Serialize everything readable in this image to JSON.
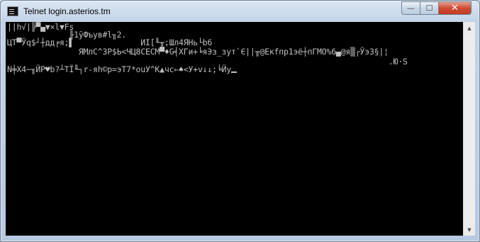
{
  "window": {
    "title": "Telnet login.asterios.tm",
    "buttons": {
      "minimize": "—",
      "maximize": "☐",
      "close": "✕"
    }
  },
  "console": {
    "lines": [
      "||h√|╠▀▄▼×l▼Fs",
      "             ╟1ўФъув#l╖2.",
      "ЦТ▀Ўq$┘┼дд╒я;▌              ИI[╙╥;Шл4ЯНь└b6",
      "               ЯМлС^3Р$Ь<ЧЦ8СЕСМ▀♦G╡ХГи+╘яЭз_зут`Є||╥@Екfпр1эё┼пГМО%6▄@я▒┌Ўэ3§|¦",
      "                                                                                .Ю·S",
      "N╪Х4~╖ЙР♥b?┴ТЇ╙┐r-яh©р=эТ7*оuУ^К▲чс←♠<У+v↓↓;╘Йу"
    ],
    "cursor": "_"
  },
  "scrollbar": {
    "up_arrow": "▲",
    "down_arrow": "▼"
  },
  "colors": {
    "console_bg": "#000000",
    "console_text": "#c0c0c0",
    "close_button": "#c94430"
  }
}
